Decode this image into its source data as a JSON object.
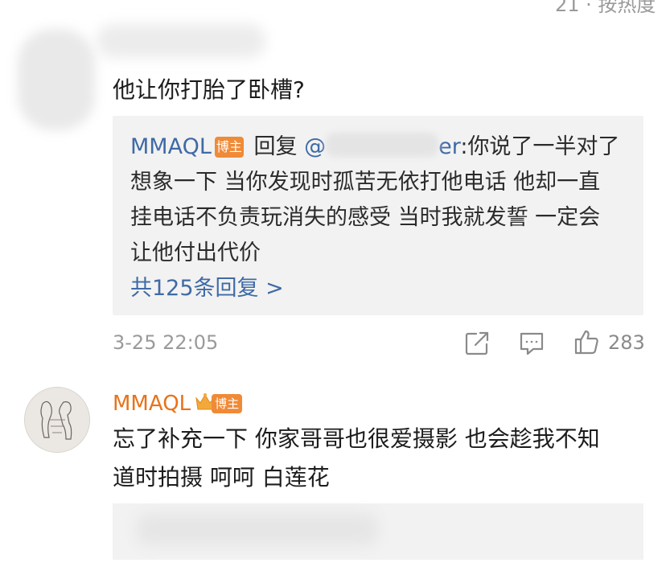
{
  "top_clipped": "21 · 按热度",
  "comment1": {
    "text": "他让你打胎了卧槽?",
    "reply_preview": {
      "author": "MMAQL",
      "author_badge": "博主",
      "reply_word": "回复",
      "mention_prefix": "@",
      "mention_suffix": "er",
      "line1_text": ":你说了一半对了",
      "line2": "想象一下 当你发现时孤苦无依打他电话 他却一直",
      "line3": "挂电话不负责玩消失的感受 当时我就发誓 一定会",
      "line4": "让他付出代价"
    },
    "more_replies": "共125条回复 >",
    "timestamp": "3-25 22:05",
    "likes": "283"
  },
  "comment2": {
    "author": "MMAQL",
    "author_badge": "博主",
    "line1": "忘了补充一下 你家哥哥也很爱摄影 也会趁我不知",
    "line2": "道时拍摄 呵呵 白莲花"
  },
  "colors": {
    "link_blue": "#3f6aa6",
    "author_orange": "#e8731a",
    "badge_orange": "#ef8a37",
    "reply_bg": "#f2f2f2",
    "meta_gray": "#9a9a9a"
  },
  "icons": [
    "share-icon",
    "comment-icon",
    "like-icon",
    "crown-icon"
  ]
}
